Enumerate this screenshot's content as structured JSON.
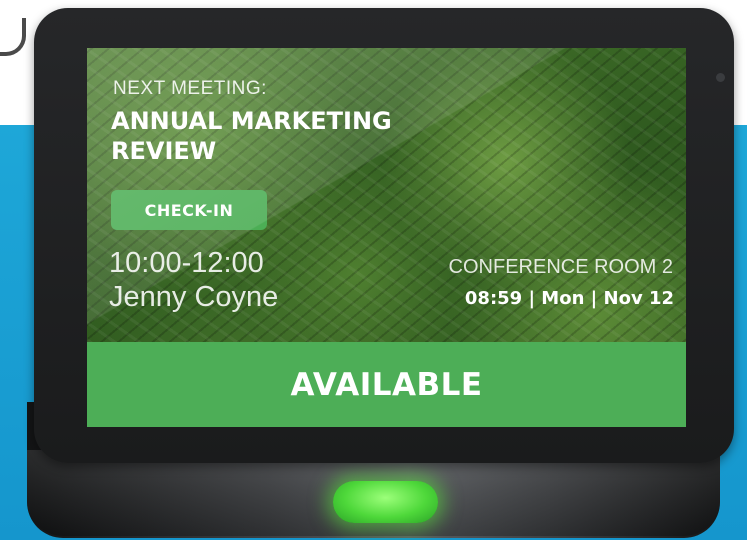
{
  "colors": {
    "background": "#1ea7d8",
    "status_available": "#4dae57",
    "checkin_button": "#4cae55",
    "led": "#4ed83a"
  },
  "screen": {
    "next_meeting_label": "NEXT MEETING:",
    "meeting_title": "ANNUAL MARKETING REVIEW",
    "checkin_label": "CHECK-IN",
    "time_range": "10:00-12:00",
    "organizer": "Jenny Coyne",
    "room_name": "CONFERENCE ROOM 2",
    "clock": "08:59 | Mon | Nov 12",
    "status": "AVAILABLE"
  },
  "icons": {
    "camera": "camera-icon",
    "led": "status-led-icon"
  }
}
